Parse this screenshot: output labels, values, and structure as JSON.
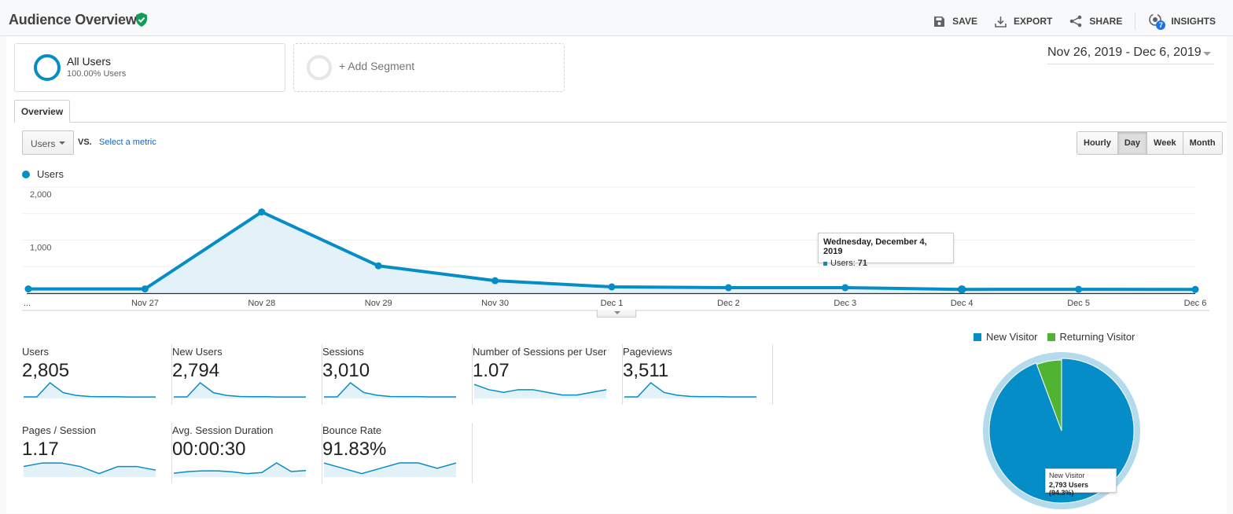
{
  "header": {
    "title": "Audience Overview",
    "verified_icon": "shield-check-icon",
    "actions": [
      {
        "label": "SAVE",
        "icon": "save-icon"
      },
      {
        "label": "EXPORT",
        "icon": "download-icon"
      },
      {
        "label": "SHARE",
        "icon": "share-icon"
      },
      {
        "label": "INSIGHTS",
        "icon": "insights-icon",
        "badge": "7"
      }
    ]
  },
  "segments": {
    "active": {
      "name": "All Users",
      "subtitle": "100.00% Users"
    },
    "add_label": "+ Add Segment"
  },
  "date_range": "Nov 26, 2019 - Dec 6, 2019",
  "tabs": [
    {
      "label": "Overview",
      "active": true
    }
  ],
  "controls": {
    "metric": "Users",
    "vs_label": "VS.",
    "select_metric": "Select a metric",
    "granularity": [
      {
        "label": "Hourly",
        "active": false
      },
      {
        "label": "Day",
        "active": true
      },
      {
        "label": "Week",
        "active": false
      },
      {
        "label": "Month",
        "active": false
      }
    ]
  },
  "colors": {
    "accent": "#058dc7",
    "returning": "#50b432",
    "area_fill": "#e3f1f8",
    "pie_ring": "#b3dbec"
  },
  "tooltip": {
    "title": "Wednesday, December 4, 2019",
    "label": "Users:",
    "value": "71"
  },
  "metrics": [
    {
      "label": "Users",
      "value": "2,805",
      "spark": [
        80,
        80,
        1530,
        515,
        235,
        118,
        103,
        103,
        71,
        73,
        70
      ]
    },
    {
      "label": "New Users",
      "value": "2,794",
      "spark": [
        79,
        79,
        1525,
        512,
        233,
        117,
        102,
        102,
        70,
        72,
        69
      ]
    },
    {
      "label": "Sessions",
      "value": "3,010",
      "spark": [
        85,
        85,
        1600,
        560,
        260,
        130,
        115,
        112,
        80,
        82,
        80
      ]
    },
    {
      "label": "Number of Sessions per User",
      "value": "1.07",
      "spark": [
        1.08,
        1.06,
        1.05,
        1.06,
        1.06,
        1.05,
        1.04,
        1.04,
        1.05,
        1.06
      ]
    },
    {
      "label": "Pageviews",
      "value": "3,511",
      "spark": [
        95,
        95,
        1850,
        650,
        300,
        155,
        130,
        128,
        95,
        96,
        92
      ]
    },
    {
      "label": "Pages / Session",
      "value": "1.17",
      "spark": [
        1.17,
        1.18,
        1.18,
        1.17,
        1.15,
        1.17,
        1.17,
        1.16
      ]
    },
    {
      "label": "Avg. Session Duration",
      "value": "00:00:30",
      "spark": [
        20,
        25,
        27,
        27,
        24,
        19,
        22,
        50,
        25,
        28
      ]
    },
    {
      "label": "Bounce Rate",
      "value": "91.83%",
      "spark": [
        91.9,
        91.8,
        91.7,
        91.8,
        91.9,
        91.9,
        91.8,
        91.9
      ]
    }
  ],
  "pie_tooltip": {
    "title": "New Visitor",
    "value": "2,793 Users (94.3%)"
  },
  "chart_data": [
    {
      "type": "area",
      "title": "",
      "legend": [
        "Users"
      ],
      "legend_position": "top-left",
      "categories": [
        "...",
        "Nov 27",
        "Nov 28",
        "Nov 29",
        "Nov 30",
        "Dec 1",
        "Dec 2",
        "Dec 3",
        "Dec 4",
        "Dec 5",
        "Dec 6"
      ],
      "series": [
        {
          "name": "Users",
          "values": [
            80,
            80,
            1530,
            515,
            235,
            118,
            103,
            103,
            71,
            73,
            70
          ]
        }
      ],
      "yticks": [
        "1,000",
        "2,000"
      ],
      "ytick_values": [
        1000,
        2000
      ],
      "ylim": [
        0,
        2000
      ],
      "grid": true,
      "xlabel": "",
      "ylabel": ""
    },
    {
      "type": "pie",
      "title": "",
      "legend_position": "top",
      "categories": [
        "New Visitor",
        "Returning Visitor"
      ],
      "values": [
        94.3,
        5.7
      ]
    }
  ]
}
